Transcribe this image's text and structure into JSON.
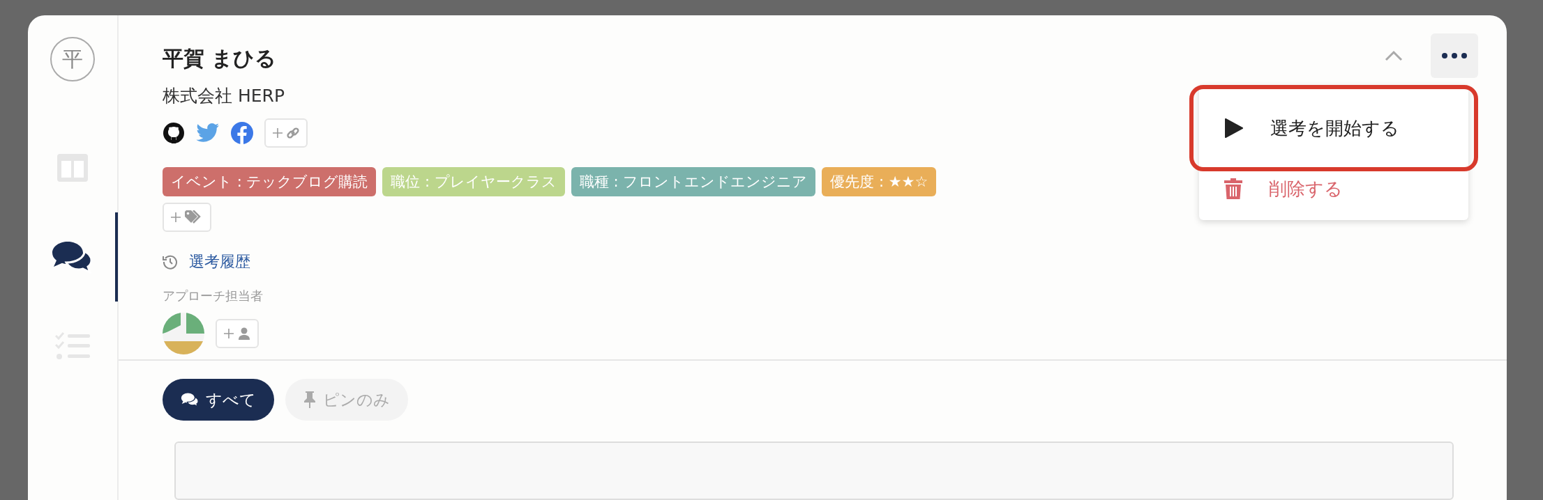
{
  "sidebar": {
    "items": [
      {
        "kind": "avatar",
        "label": "平",
        "selected": false
      },
      {
        "kind": "board",
        "selected": false
      },
      {
        "kind": "comments",
        "selected": true
      },
      {
        "kind": "checklist",
        "selected": false
      }
    ]
  },
  "profile": {
    "name": "平賀 まひる",
    "company": "株式会社 HERP",
    "links": [
      {
        "kind": "github"
      },
      {
        "kind": "twitter"
      },
      {
        "kind": "facebook"
      }
    ],
    "tags": [
      {
        "label": "イベント : テックブログ購読",
        "color": "#cd6f6b"
      },
      {
        "label": "職位 : プレイヤークラス",
        "color": "#bcd68c"
      },
      {
        "label": "職種 : フロントエンドエンジニア",
        "color": "#7bb3ac"
      },
      {
        "label": "優先度 : ★★☆",
        "color": "#e9ae58"
      }
    ],
    "history_link": "選考履歴",
    "assignees_label": "アプローチ担当者"
  },
  "menu": {
    "open": true,
    "items": [
      {
        "kind": "start",
        "label": "選考を開始する",
        "highlighted": true
      },
      {
        "kind": "delete",
        "label": "削除する",
        "highlighted": false
      }
    ]
  },
  "tabs": [
    {
      "kind": "all",
      "label": "すべて",
      "selected": true
    },
    {
      "kind": "pinned",
      "label": "ピンのみ",
      "selected": false
    }
  ]
}
